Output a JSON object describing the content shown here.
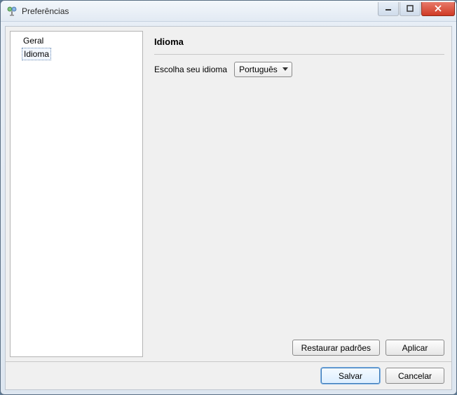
{
  "window": {
    "title": "Preferências"
  },
  "sidebar": {
    "items": [
      {
        "label": "Geral",
        "selected": false
      },
      {
        "label": "Idioma",
        "selected": true
      }
    ]
  },
  "main": {
    "heading": "Idioma",
    "language_row": {
      "label": "Escolha seu idioma",
      "selected": "Português"
    },
    "buttons": {
      "restore_defaults": "Restaurar padrões",
      "apply": "Aplicar"
    }
  },
  "dialog_buttons": {
    "save": "Salvar",
    "cancel": "Cancelar"
  }
}
